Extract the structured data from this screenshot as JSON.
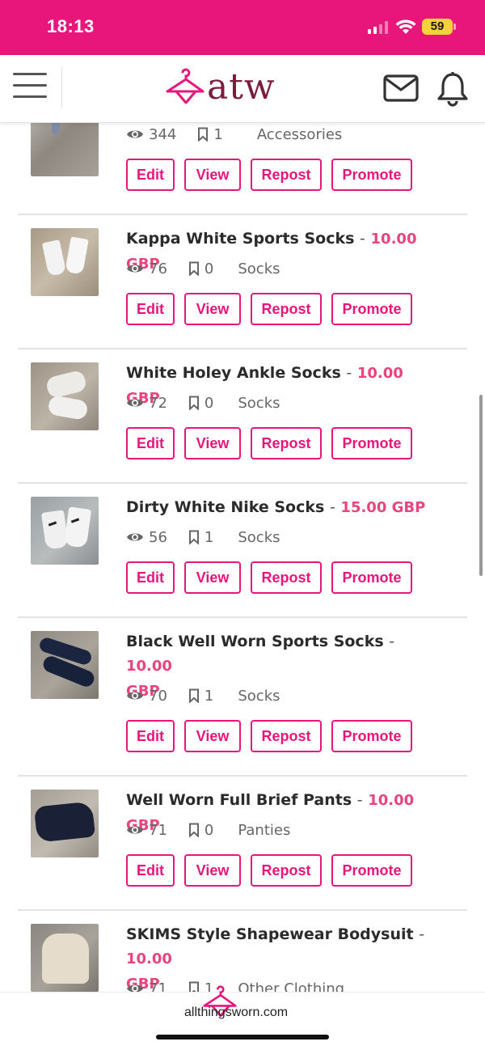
{
  "status_bar": {
    "time": "18:13",
    "battery": "59"
  },
  "header": {
    "logo_text": "atw"
  },
  "buttons": {
    "edit": "Edit",
    "view": "View",
    "repost": "Repost",
    "promote": "Promote"
  },
  "listings": [
    {
      "title": "",
      "price": "",
      "views": "344",
      "saves": "1",
      "category": "Accessories"
    },
    {
      "title": "Kappa White Sports Socks",
      "price": "10.00 GBP",
      "views": "76",
      "saves": "0",
      "category": "Socks"
    },
    {
      "title": "White Holey Ankle Socks",
      "price": "10.00 GBP",
      "views": "72",
      "saves": "0",
      "category": "Socks"
    },
    {
      "title": "Dirty White Nike Socks",
      "price": "15.00 GBP",
      "views": "56",
      "saves": "1",
      "category": "Socks"
    },
    {
      "title": "Black Well Worn Sports Socks",
      "price_part1": "10.00",
      "price_part2": "GBP",
      "views": "70",
      "saves": "1",
      "category": "Socks"
    },
    {
      "title": "Well Worn Full Brief Pants",
      "price": "10.00 GBP",
      "views": "71",
      "saves": "0",
      "category": "Panties"
    },
    {
      "title": "SKIMS Style Shapewear Bodysuit",
      "price_part1": "10.00",
      "price_part2": "GBP",
      "views": "71",
      "saves": "1",
      "category": "Other Clothing"
    }
  ],
  "dash": "-",
  "bottom_bar": {
    "domain": "allthingsworn.com"
  },
  "colors": {
    "brand_pink": "#e8157a",
    "price_pink": "#e8457f",
    "logo_maroon": "#7a1c3a"
  },
  "icons": {
    "views": "eye-icon",
    "saves": "bookmark-icon",
    "menu": "hamburger-icon",
    "mail": "mail-icon",
    "notifications": "bell-icon"
  }
}
